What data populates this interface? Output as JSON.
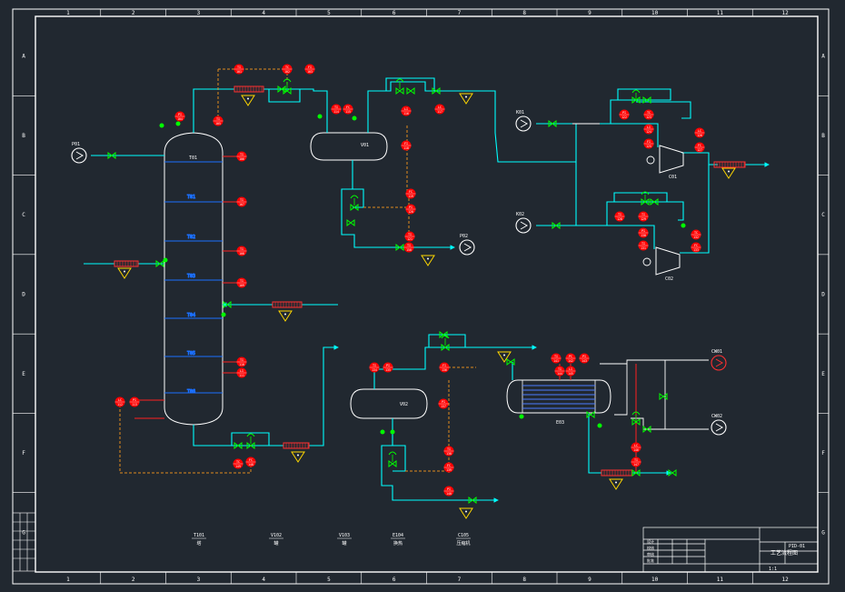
{
  "frame": {
    "columns": [
      "1",
      "2",
      "3",
      "4",
      "5",
      "6",
      "7",
      "8",
      "9",
      "10",
      "11",
      "12"
    ],
    "rows": [
      "A",
      "B",
      "C",
      "D",
      "E",
      "F",
      "G"
    ]
  },
  "colors": {
    "background": "#212830",
    "process": "#00ffff",
    "utility": "#ffffff",
    "valve": "#00ff00",
    "instrument": "#ff0000",
    "signal": "#e08a1e",
    "warning": "#ffd800",
    "exchanger": "#ff3030"
  },
  "column": {
    "tag": "T01",
    "trays": [
      "T01",
      "T02",
      "T03",
      "T04",
      "T05",
      "T06"
    ]
  },
  "drum_top": {
    "tag": "V01"
  },
  "drum_bottom": {
    "tag": "V02"
  },
  "exchanger": {
    "tag": "E03"
  },
  "pumps": [
    {
      "id": "feed-pump",
      "tag": "P01"
    },
    {
      "id": "reflux-pump",
      "tag": "P02"
    },
    {
      "id": "compressor-inlet-1",
      "tag": "K01"
    },
    {
      "id": "compressor-inlet-2",
      "tag": "K02"
    },
    {
      "id": "coolant-supply",
      "tag": "CW01"
    },
    {
      "id": "coolant-return",
      "tag": "CW02"
    }
  ],
  "compressors": [
    {
      "tag": "C01"
    },
    {
      "tag": "C02"
    }
  ],
  "instruments": [
    {
      "id": "ti-1",
      "t": "TI",
      "n": "101"
    },
    {
      "id": "ti-2",
      "t": "TC",
      "n": "102"
    },
    {
      "id": "ti-3",
      "t": "FI",
      "n": "103"
    },
    {
      "id": "ti-4",
      "t": "PI",
      "n": "104"
    },
    {
      "id": "ti-5",
      "t": "TI",
      "n": "105"
    },
    {
      "id": "ti-6",
      "t": "TI",
      "n": "106"
    },
    {
      "id": "ti-7",
      "t": "TI",
      "n": "107"
    },
    {
      "id": "ti-8",
      "t": "TI",
      "n": "108"
    },
    {
      "id": "ti-9",
      "t": "TI",
      "n": "109"
    },
    {
      "id": "ti-10",
      "t": "TI",
      "n": "110"
    },
    {
      "id": "ti-11",
      "t": "LI",
      "n": "111"
    },
    {
      "id": "ti-12",
      "t": "LC",
      "n": "112"
    },
    {
      "id": "ti-13",
      "t": "PI",
      "n": "113"
    },
    {
      "id": "ti-14",
      "t": "TI",
      "n": "114"
    },
    {
      "id": "ti-15",
      "t": "FC",
      "n": "115"
    },
    {
      "id": "ti-16",
      "t": "LI",
      "n": "116"
    },
    {
      "id": "ti-17",
      "t": "LC",
      "n": "117"
    },
    {
      "id": "ti-18",
      "t": "FI",
      "n": "118"
    },
    {
      "id": "ti-19",
      "t": "FC",
      "n": "119"
    },
    {
      "id": "ti-20",
      "t": "PI",
      "n": "120"
    },
    {
      "id": "ti-21",
      "t": "TI",
      "n": "121"
    },
    {
      "id": "ti-22",
      "t": "PI",
      "n": "122"
    },
    {
      "id": "ti-23",
      "t": "TC",
      "n": "123"
    },
    {
      "id": "ti-24",
      "t": "LI",
      "n": "124"
    },
    {
      "id": "ti-25",
      "t": "FI",
      "n": "125"
    },
    {
      "id": "ti-26",
      "t": "LC",
      "n": "126"
    },
    {
      "id": "ti-27",
      "t": "FC",
      "n": "127"
    },
    {
      "id": "ti-28",
      "t": "TI",
      "n": "128"
    },
    {
      "id": "ti-29",
      "t": "TI",
      "n": "129"
    },
    {
      "id": "ti-30",
      "t": "PI",
      "n": "130"
    },
    {
      "id": "ti-31",
      "t": "TI",
      "n": "131"
    },
    {
      "id": "ti-32",
      "t": "TC",
      "n": "132"
    },
    {
      "id": "ti-33",
      "t": "FC",
      "n": "133"
    },
    {
      "id": "ti-34",
      "t": "TI",
      "n": "134"
    },
    {
      "id": "ti-35",
      "t": "PI",
      "n": "135"
    },
    {
      "id": "ti-36",
      "t": "FI",
      "n": "136"
    },
    {
      "id": "ti-37",
      "t": "PI",
      "n": "137"
    },
    {
      "id": "ti-38",
      "t": "TI",
      "n": "138"
    },
    {
      "id": "ti-39",
      "t": "FC",
      "n": "139"
    },
    {
      "id": "ti-40",
      "t": "PI",
      "n": "140"
    },
    {
      "id": "ti-41",
      "t": "TI",
      "n": "141"
    },
    {
      "id": "ti-42",
      "t": "PC",
      "n": "142"
    },
    {
      "id": "ti-43",
      "t": "PI",
      "n": "143"
    },
    {
      "id": "ti-44",
      "t": "TI",
      "n": "144"
    },
    {
      "id": "ti-45",
      "t": "LI",
      "n": "145"
    },
    {
      "id": "ti-46",
      "t": "LC",
      "n": "146"
    },
    {
      "id": "ti-47",
      "t": "TI",
      "n": "147"
    },
    {
      "id": "ti-48",
      "t": "FC",
      "n": "148"
    },
    {
      "id": "ti-49",
      "t": "TC",
      "n": "149"
    },
    {
      "id": "ti-50",
      "t": "TI",
      "n": "150"
    }
  ],
  "legend": [
    {
      "id": "legend-1",
      "code": "T101",
      "label": "塔"
    },
    {
      "id": "legend-2",
      "code": "V102",
      "label": "罐"
    },
    {
      "id": "legend-3",
      "code": "V103",
      "label": "罐"
    },
    {
      "id": "legend-4",
      "code": "E104",
      "label": "换热"
    },
    {
      "id": "legend-5",
      "code": "C105",
      "label": "压缩机"
    }
  ],
  "title_block": {
    "rows": [
      [
        "设计",
        "",
        "",
        ""
      ],
      [
        "校核",
        "",
        "",
        ""
      ],
      [
        "审核",
        "",
        "",
        ""
      ],
      [
        "批准",
        "",
        "",
        ""
      ]
    ],
    "title": "工艺流程图",
    "project": "",
    "drawing_no": "PID-01",
    "bottom": "1:1"
  }
}
